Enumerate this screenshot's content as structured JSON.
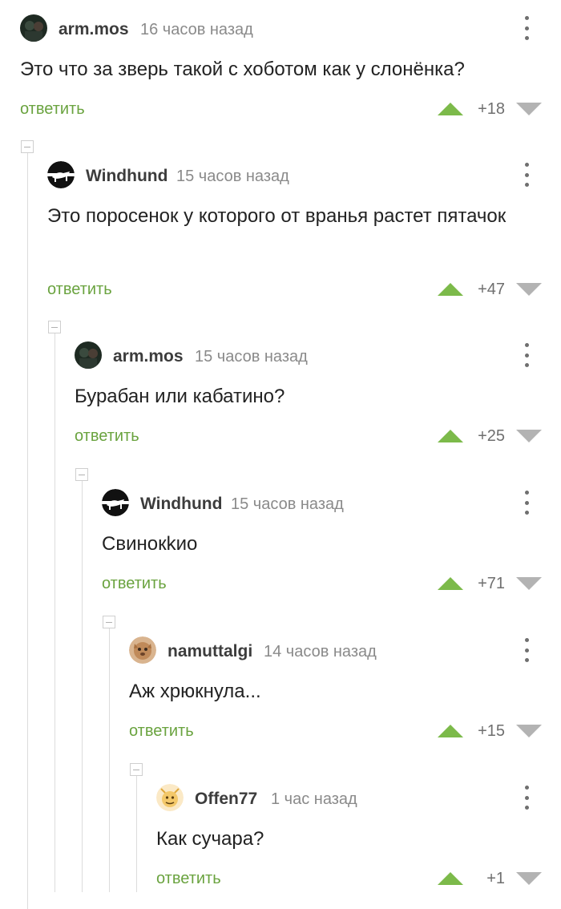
{
  "comments": [
    {
      "username": "arm.mos",
      "time": "16 часов назад",
      "text": "Это что за зверь такой с хоботом как у слонёнка?",
      "reply_label": "ответить",
      "score": "+18"
    },
    {
      "username": "Windhund",
      "time": "15 часов назад",
      "text": "Это поросенок у которого от вранья растет пятачок",
      "reply_label": "ответить",
      "score": "+47"
    },
    {
      "username": "arm.mos",
      "time": "15 часов назад",
      "text": "Бурабан или кабатино?",
      "reply_label": "ответить",
      "score": "+25"
    },
    {
      "username": "Windhund",
      "time": "15 часов назад",
      "text": "Свинокkио",
      "reply_label": "ответить",
      "score": "+71"
    },
    {
      "username": "namuttalgi",
      "time": "14 часов назад",
      "text": "Аж хрюкнула...",
      "reply_label": "ответить",
      "score": "+15"
    },
    {
      "username": "Offen77",
      "time": "1 час назад",
      "text": "Как сучара?",
      "reply_label": "ответить",
      "score": "+1"
    }
  ],
  "icons": {
    "upvote": "upvote-arrow-icon",
    "downvote": "downvote-arrow-icon",
    "more": "more-vertical-icon",
    "collapse": "collapse-thread-icon"
  },
  "colors": {
    "reply": "#6aa33f",
    "upvote": "#7cba4a",
    "downvote": "#b3b3b3"
  }
}
